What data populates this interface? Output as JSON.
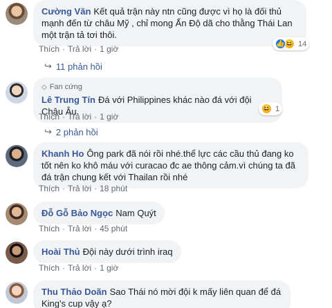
{
  "comments": [
    {
      "name": "Cường Văn",
      "text": "Kết quả trận này ntn cũng được vì họ là đối thủ mạnh đến từ châu Mỹ , chỉ mong Ấn Độ dã cho thằng Thái Lan một trận tả tơi thôi.",
      "like": "Thích",
      "reply": "Trả lời",
      "time": "1 giờ",
      "reaction_count": "14",
      "replies": "11 phản hồi"
    },
    {
      "badge": "Fan cứng",
      "name": "Lê Trung Tín",
      "text": "Đá với Philippines khác nào đá với đội Châu Âu.",
      "like": "Thích",
      "reply": "Trả lời",
      "time": "1 giờ",
      "reaction_count": "1",
      "replies": "2 phản hồi"
    },
    {
      "name": "Khanh Ho",
      "text": "Ông park đã nói rồi nhé.thể lực các cầu thủ đang ko tốt nên ko khô máu với curacao đc ae thông cảm.vì chúng ta đã đá trận chung kết với Thailan rồi nhé",
      "like": "Thích",
      "reply": "Trả lời",
      "time": "18 phút"
    },
    {
      "name": "Đỗ Gỗ Bảo Ngọc",
      "text": "Nam Quýt",
      "like": "Thích",
      "reply": "Trả lời",
      "time": "45 phút"
    },
    {
      "name": "Hoài Thủ",
      "text": "Đội này dưới trình iraq",
      "like": "Thích",
      "reply": "Trả lời",
      "time": "1 giờ"
    },
    {
      "name": "Thu Thảo Doãn",
      "text": "Sao Thái nó mời đội k mấy liên quan để đá King's cup vậy ạ?"
    }
  ],
  "icons": {
    "like": "thumbs-up-icon",
    "haha": "laugh-icon",
    "reply_arrow": "reply-arrow-icon",
    "badge": "diamond-icon"
  },
  "colors": {
    "name": "#385898",
    "bubble": "#f2f3f5",
    "meta": "#606770",
    "like": "#1877f2",
    "haha": "#f7b125"
  }
}
